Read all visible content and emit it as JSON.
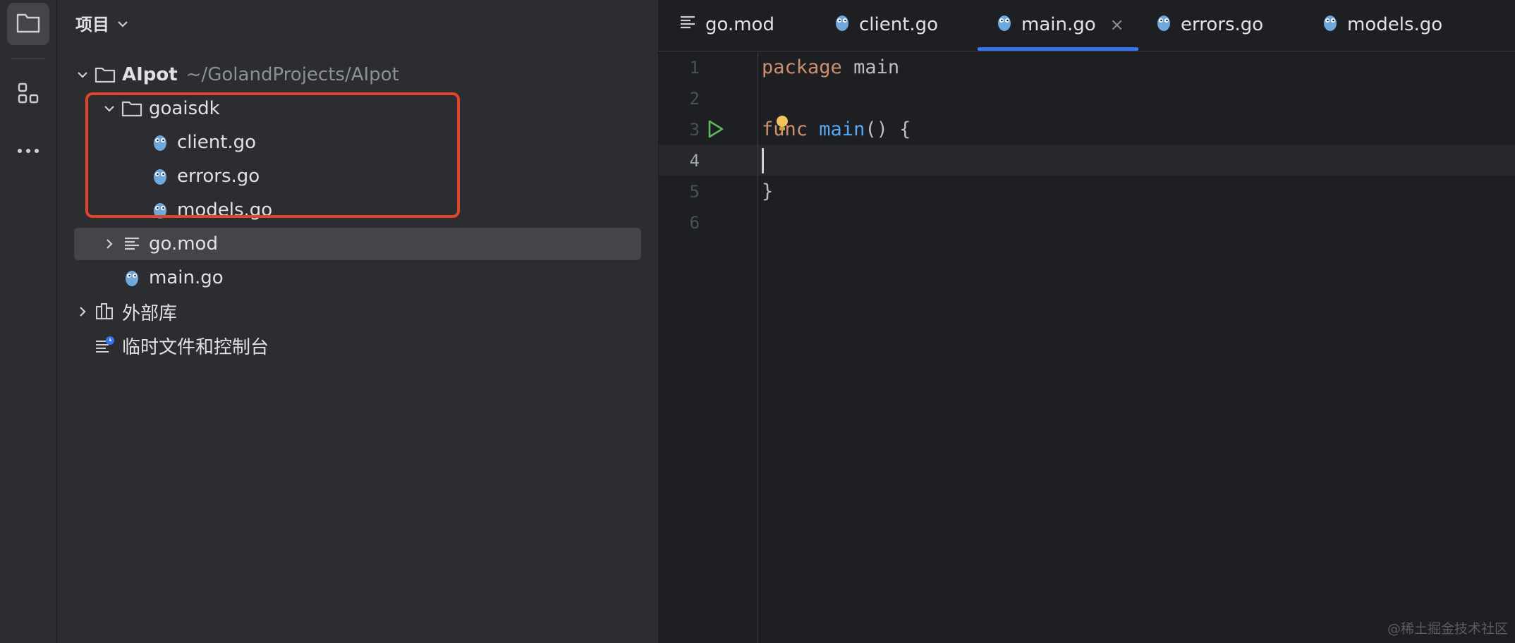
{
  "activity_bar": {
    "items": [
      {
        "icon": "folder-icon",
        "active": true
      },
      {
        "icon": "structure-icon",
        "active": false
      },
      {
        "icon": "more-icon",
        "active": false
      }
    ]
  },
  "project_panel": {
    "title": "项目",
    "tree": {
      "root": {
        "name": "AIpot",
        "path": "~/GolandProjects/AIpot"
      },
      "folder": {
        "name": "goaisdk"
      },
      "folder_files": [
        "client.go",
        "errors.go",
        "models.go"
      ],
      "gomod": "go.mod",
      "maingo": "main.go",
      "external": "外部库",
      "scratches": "临时文件和控制台"
    }
  },
  "editor": {
    "tabs": [
      {
        "label": "go.mod",
        "icon": "text-file-icon"
      },
      {
        "label": "client.go",
        "icon": "gopher-icon"
      },
      {
        "label": "main.go",
        "icon": "gopher-icon",
        "active": true
      },
      {
        "label": "errors.go",
        "icon": "gopher-icon"
      },
      {
        "label": "models.go",
        "icon": "gopher-icon"
      }
    ],
    "close_glyph": "×",
    "line_numbers": [
      "1",
      "2",
      "3",
      "4",
      "5",
      "6"
    ],
    "current_line": 4,
    "code": {
      "l1_kw": "package",
      "l1_name": "main",
      "l3_kw": "func",
      "l3_fn": "main",
      "l3_rest": "() {",
      "l5": "}"
    }
  },
  "watermark": "@稀土掘金技术社区",
  "colors": {
    "accent": "#3574f0",
    "keyword": "#cf8e6d",
    "function": "#56a8f5",
    "highlight_box": "#e2432b",
    "run_icon": "#5fb85f",
    "bulb": "#f2c55c"
  }
}
